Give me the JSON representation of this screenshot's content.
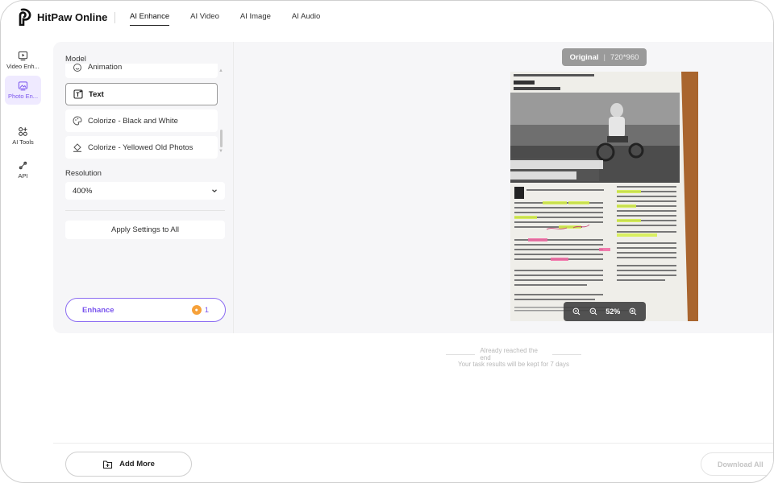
{
  "app": {
    "name": "HitPaw Online"
  },
  "nav": {
    "items": [
      "AI Enhance",
      "AI Video",
      "AI Image",
      "AI Audio"
    ],
    "active": "AI Enhance"
  },
  "sidebar": {
    "items": [
      {
        "label": "Video Enh...",
        "icon": "video-enhance-icon"
      },
      {
        "label": "Photo En...",
        "icon": "photo-enhance-icon",
        "active": true
      },
      {
        "label": "AI Tools",
        "icon": "ai-tools-icon"
      },
      {
        "label": "API",
        "icon": "api-icon"
      }
    ]
  },
  "settings": {
    "model_label": "Model",
    "models": [
      {
        "label": "Animation",
        "icon": "animation-icon"
      },
      {
        "label": "Text",
        "icon": "text-model-icon",
        "selected": true
      },
      {
        "label": "Colorize - Black and White",
        "icon": "palette-icon"
      },
      {
        "label": "Colorize - Yellowed Old Photos",
        "icon": "bucket-icon"
      }
    ],
    "resolution_label": "Resolution",
    "resolution_value": "400%",
    "apply_label": "Apply Settings to All",
    "enhance_label": "Enhance",
    "credit_cost": "1"
  },
  "preview": {
    "badge_title": "Original",
    "badge_dims": "720*960",
    "zoom": "52%"
  },
  "results": {
    "end_text": "Already reached the end",
    "keep_note": "Your task results will be kept for 7 days"
  },
  "footer": {
    "add_more": "Add More",
    "download_all": "Download All"
  },
  "colors": {
    "accent": "#7a55ee",
    "coin": "#f6a13a"
  }
}
